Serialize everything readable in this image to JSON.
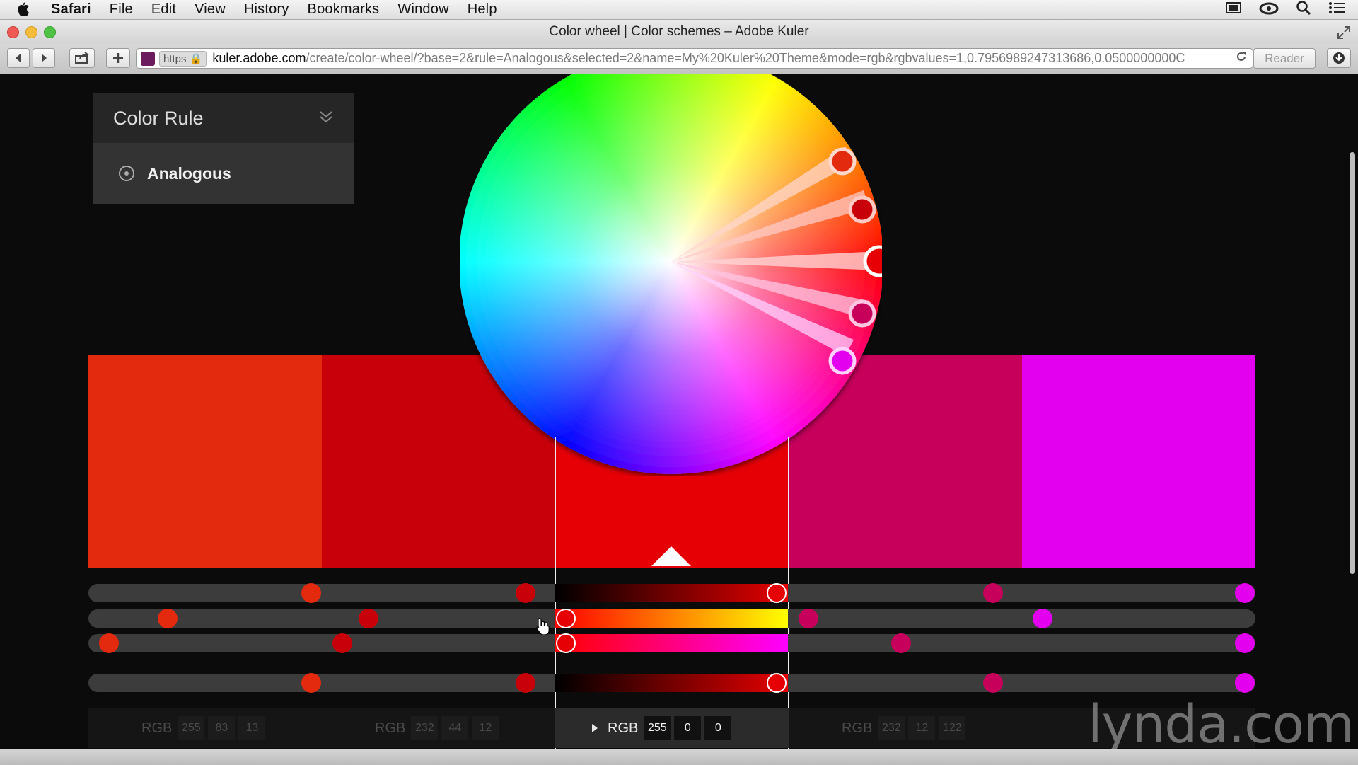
{
  "menubar": {
    "app": "Safari",
    "items": [
      "File",
      "Edit",
      "View",
      "History",
      "Bookmarks",
      "Window",
      "Help"
    ]
  },
  "window": {
    "title": "Color wheel | Color schemes – Adobe Kuler"
  },
  "toolbar": {
    "https_label": "https",
    "url_host": "kuler.adobe.com",
    "url_path": "/create/color-wheel/?base=2&rule=Analogous&selected=2&name=My%20Kuler%20Theme&mode=rgb&rgbvalues=1,0.7956989247313686,0.0500000000C",
    "reader_label": "Reader"
  },
  "color_rule": {
    "heading": "Color Rule",
    "selected": "Analogous"
  },
  "colors": {
    "swatches": [
      "#e32a0e",
      "#c8000a",
      "#e60006",
      "#c6005b",
      "#e300ee"
    ],
    "selected_index": 2
  },
  "values": [
    {
      "mode": "RGB",
      "r": "255",
      "g": "83",
      "b": "13"
    },
    {
      "mode": "RGB",
      "r": "232",
      "g": "44",
      "b": "12"
    },
    {
      "mode": "RGB",
      "r": "255",
      "g": "0",
      "b": "0"
    },
    {
      "mode": "RGB",
      "r": "232",
      "g": "12",
      "b": "122"
    }
  ],
  "watermark": "lynda.com"
}
